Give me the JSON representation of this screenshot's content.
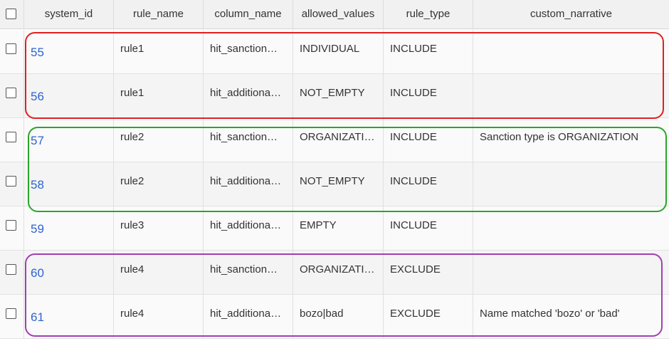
{
  "columns": [
    "system_id",
    "rule_name",
    "column_name",
    "allowed_values",
    "rule_type",
    "custom_narrative"
  ],
  "rows": [
    {
      "system_id": "55",
      "rule_name": "rule1",
      "column_name": "hit_sanction…",
      "allowed_values": "INDIVIDUAL",
      "rule_type": "INCLUDE",
      "custom_narrative": ""
    },
    {
      "system_id": "56",
      "rule_name": "rule1",
      "column_name": "hit_additiona…",
      "allowed_values": "NOT_EMPTY",
      "rule_type": "INCLUDE",
      "custom_narrative": ""
    },
    {
      "system_id": "57",
      "rule_name": "rule2",
      "column_name": "hit_sanction…",
      "allowed_values": "ORGANIZATI…",
      "rule_type": "INCLUDE",
      "custom_narrative": "Sanction type is ORGANIZATION"
    },
    {
      "system_id": "58",
      "rule_name": "rule2",
      "column_name": "hit_additiona…",
      "allowed_values": "NOT_EMPTY",
      "rule_type": "INCLUDE",
      "custom_narrative": ""
    },
    {
      "system_id": "59",
      "rule_name": "rule3",
      "column_name": "hit_additiona…",
      "allowed_values": "EMPTY",
      "rule_type": "INCLUDE",
      "custom_narrative": ""
    },
    {
      "system_id": "60",
      "rule_name": "rule4",
      "column_name": "hit_sanction…",
      "allowed_values": "ORGANIZATI…",
      "rule_type": "EXCLUDE",
      "custom_narrative": ""
    },
    {
      "system_id": "61",
      "rule_name": "rule4",
      "column_name": "hit_additiona…",
      "allowed_values": "bozo|bad",
      "rule_type": "EXCLUDE",
      "custom_narrative": "Name matched 'bozo' or 'bad'"
    }
  ],
  "highlight_colors": {
    "rule1": "#e02020",
    "rule2": "#2aa52a",
    "rule4": "#a040b0"
  }
}
